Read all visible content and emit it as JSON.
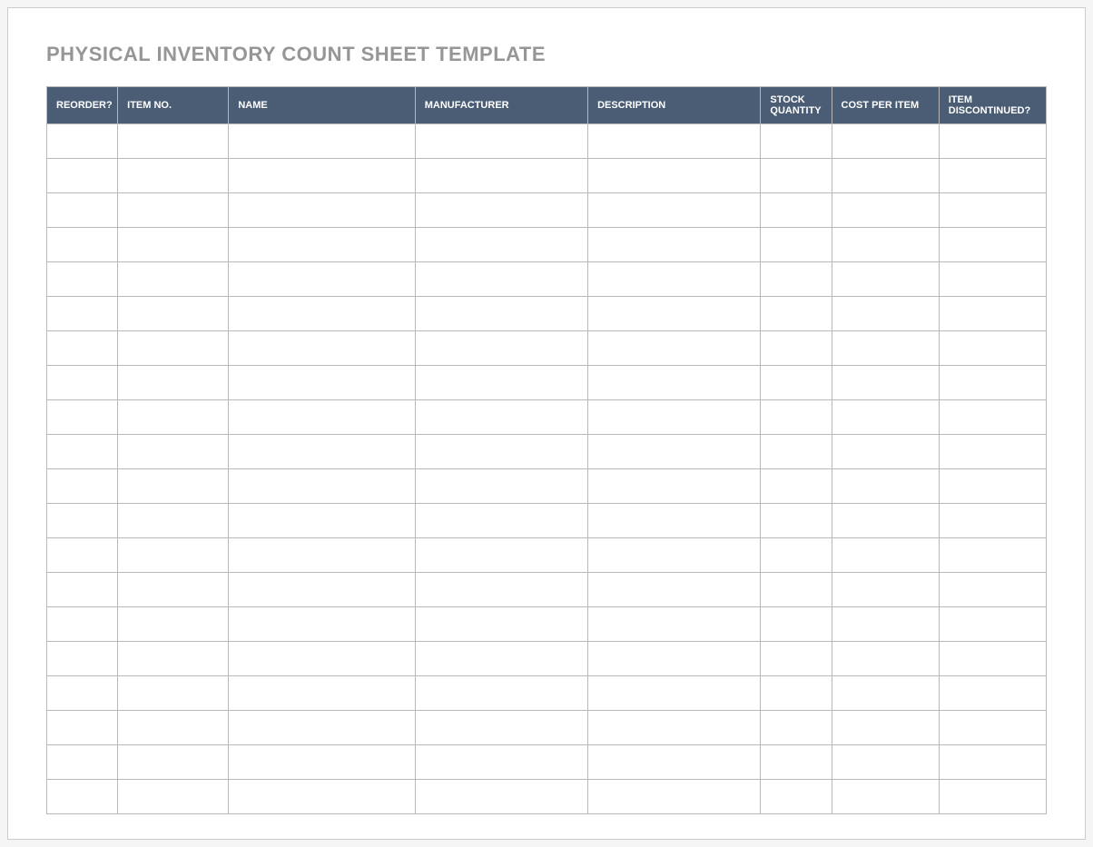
{
  "title": "PHYSICAL INVENTORY COUNT SHEET TEMPLATE",
  "columns": [
    {
      "label": "REORDER?",
      "class": "col-reorder"
    },
    {
      "label": "ITEM NO.",
      "class": "col-itemno"
    },
    {
      "label": "NAME",
      "class": "col-name"
    },
    {
      "label": "MANUFACTURER",
      "class": "col-manufacturer"
    },
    {
      "label": "DESCRIPTION",
      "class": "col-description"
    },
    {
      "label": "STOCK QUANTITY",
      "class": "col-stock"
    },
    {
      "label": "COST PER ITEM",
      "class": "col-cost"
    },
    {
      "label": "ITEM DISCONTINUED?",
      "class": "col-discontinued"
    }
  ],
  "rows": [
    [
      "",
      "",
      "",
      "",
      "",
      "",
      "",
      ""
    ],
    [
      "",
      "",
      "",
      "",
      "",
      "",
      "",
      ""
    ],
    [
      "",
      "",
      "",
      "",
      "",
      "",
      "",
      ""
    ],
    [
      "",
      "",
      "",
      "",
      "",
      "",
      "",
      ""
    ],
    [
      "",
      "",
      "",
      "",
      "",
      "",
      "",
      ""
    ],
    [
      "",
      "",
      "",
      "",
      "",
      "",
      "",
      ""
    ],
    [
      "",
      "",
      "",
      "",
      "",
      "",
      "",
      ""
    ],
    [
      "",
      "",
      "",
      "",
      "",
      "",
      "",
      ""
    ],
    [
      "",
      "",
      "",
      "",
      "",
      "",
      "",
      ""
    ],
    [
      "",
      "",
      "",
      "",
      "",
      "",
      "",
      ""
    ],
    [
      "",
      "",
      "",
      "",
      "",
      "",
      "",
      ""
    ],
    [
      "",
      "",
      "",
      "",
      "",
      "",
      "",
      ""
    ],
    [
      "",
      "",
      "",
      "",
      "",
      "",
      "",
      ""
    ],
    [
      "",
      "",
      "",
      "",
      "",
      "",
      "",
      ""
    ],
    [
      "",
      "",
      "",
      "",
      "",
      "",
      "",
      ""
    ],
    [
      "",
      "",
      "",
      "",
      "",
      "",
      "",
      ""
    ],
    [
      "",
      "",
      "",
      "",
      "",
      "",
      "",
      ""
    ],
    [
      "",
      "",
      "",
      "",
      "",
      "",
      "",
      ""
    ],
    [
      "",
      "",
      "",
      "",
      "",
      "",
      "",
      ""
    ],
    [
      "",
      "",
      "",
      "",
      "",
      "",
      "",
      ""
    ]
  ]
}
